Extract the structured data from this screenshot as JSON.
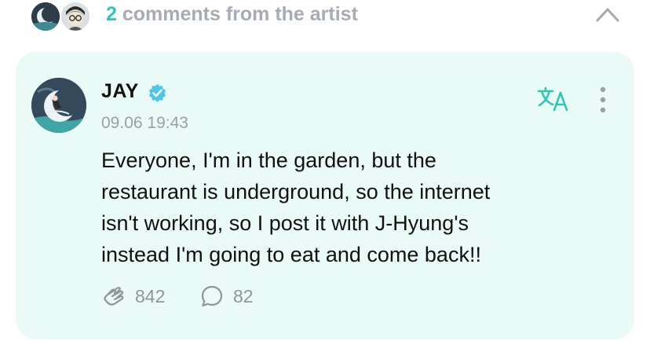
{
  "header": {
    "count": "2",
    "title_rest": " comments from the artist",
    "collapse_icon": "chevron-up-icon"
  },
  "comment": {
    "author": "JAY",
    "verified": true,
    "timestamp": "09.06 19:43",
    "lines": [
      "Everyone, I'm in the garden, but the",
      "restaurant is underground, so the internet",
      "isn't working, so I post it with J-Hyung's",
      "instead I'm going to eat and come back!!"
    ],
    "likes": "842",
    "replies": "82",
    "icons": {
      "translate": "translate-icon",
      "more": "more-vertical-icon",
      "like": "like-icon",
      "reply": "comment-bubble-icon",
      "verified": "verified-badge-icon"
    }
  },
  "colors": {
    "accent": "#2fc8b5",
    "card_bg": "#e9faf7",
    "muted_text": "#9aa1a6",
    "body_text": "#111111",
    "verified_badge": "#48c6ec"
  }
}
